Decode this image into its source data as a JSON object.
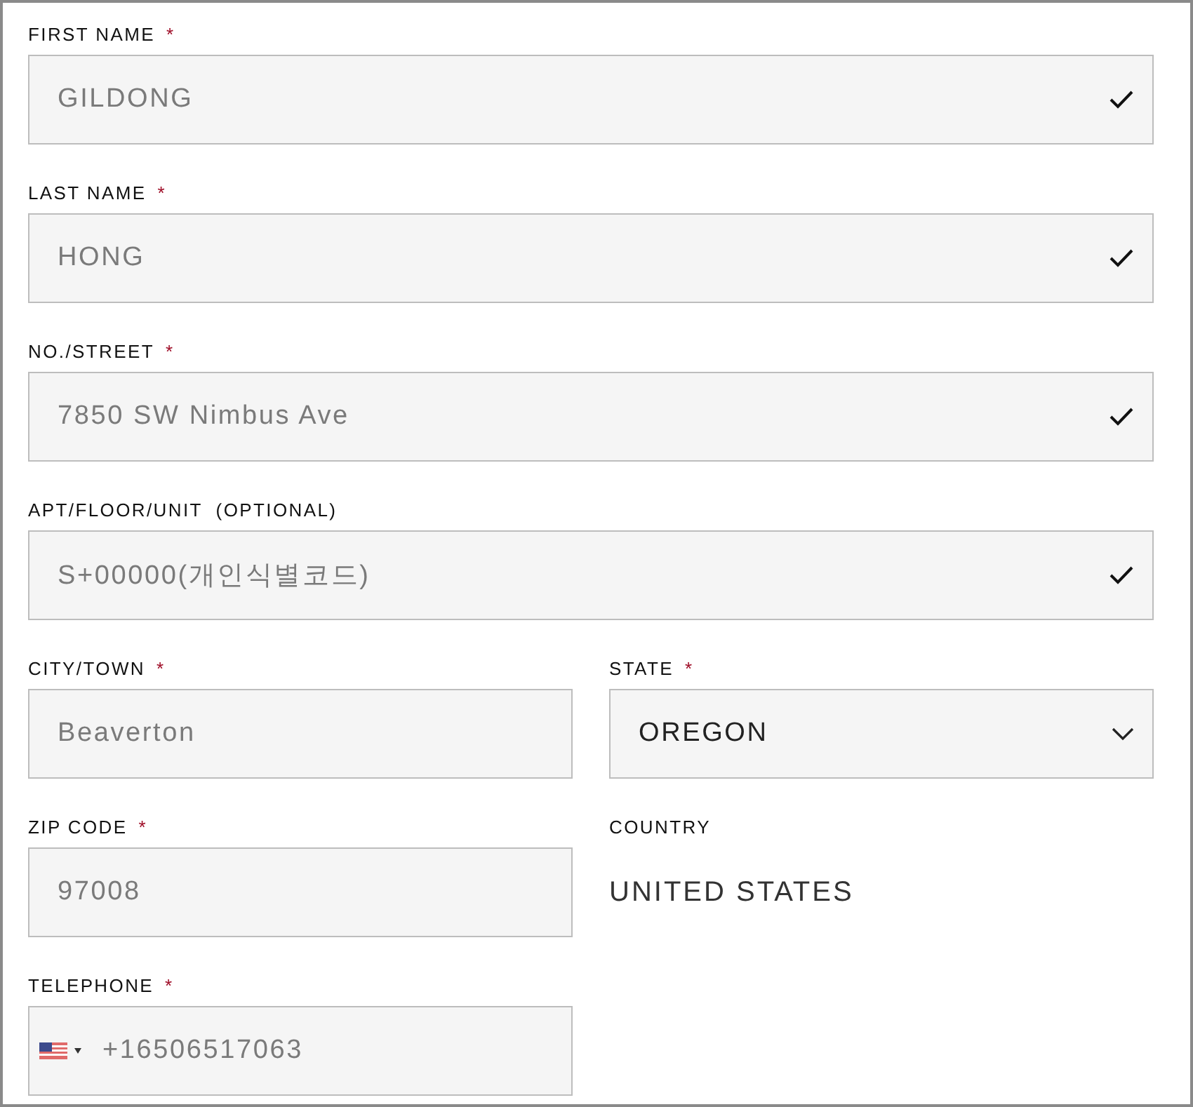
{
  "rows": [
    [
      {
        "kind": "text",
        "label": "FIRST NAME",
        "required_mark": "*",
        "value": "GILDONG",
        "validated": true
      }
    ],
    [
      {
        "kind": "text",
        "label": "LAST NAME",
        "required_mark": "*",
        "value": "HONG",
        "validated": true
      }
    ],
    [
      {
        "kind": "text",
        "label": "NO./STREET",
        "required_mark": "*",
        "value": "7850 SW Nimbus Ave",
        "validated": true
      }
    ],
    [
      {
        "kind": "text",
        "label": "APT/FLOOR/UNIT  (OPTIONAL)",
        "value": "S+00000(개인식별코드)",
        "validated": true
      }
    ],
    [
      {
        "kind": "text",
        "label": "CITY/TOWN",
        "required_mark": "*",
        "value": "Beaverton",
        "validated": false
      },
      {
        "kind": "select",
        "label": "STATE",
        "required_mark": "*",
        "value": "OREGON"
      }
    ],
    [
      {
        "kind": "text",
        "label": "ZIP CODE",
        "required_mark": "*",
        "value": "97008",
        "validated": false
      },
      {
        "kind": "static",
        "label": "COUNTRY",
        "value": "UNITED STATES"
      }
    ],
    [
      {
        "kind": "phone",
        "label": "TELEPHONE",
        "required_mark": "*",
        "value": "+16506517063"
      }
    ]
  ]
}
